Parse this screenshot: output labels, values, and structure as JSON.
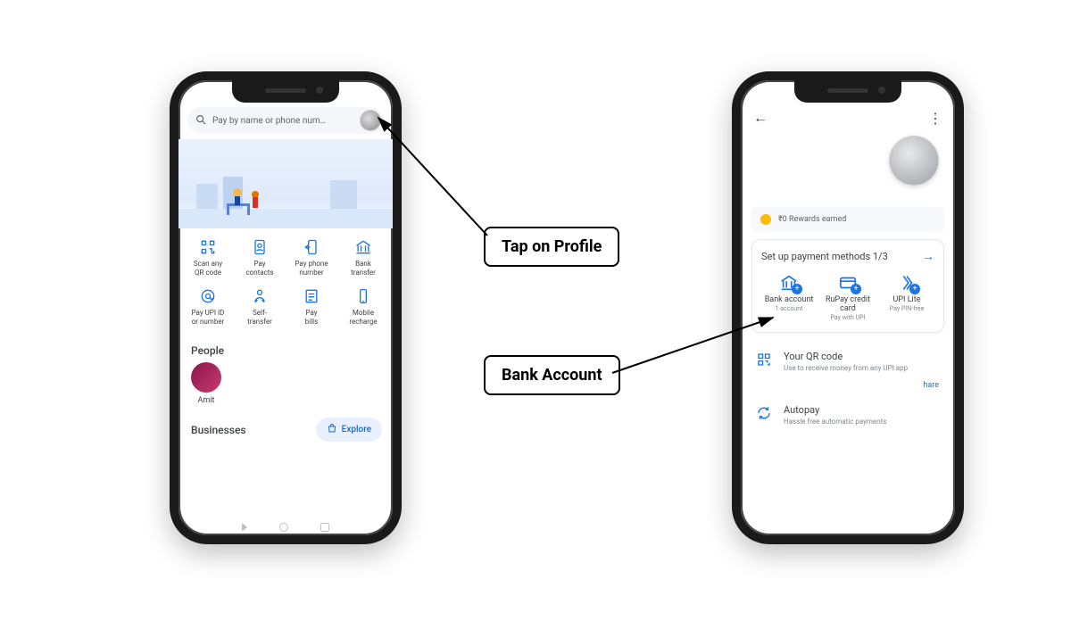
{
  "left": {
    "search_placeholder": "Pay by name or phone num…",
    "actions": [
      {
        "label1": "Scan any",
        "label2": "QR code"
      },
      {
        "label1": "Pay",
        "label2": "contacts"
      },
      {
        "label1": "Pay phone",
        "label2": "number"
      },
      {
        "label1": "Bank",
        "label2": "transfer"
      },
      {
        "label1": "Pay UPI ID",
        "label2": "or number"
      },
      {
        "label1": "Self-",
        "label2": "transfer"
      },
      {
        "label1": "Pay",
        "label2": "bills"
      },
      {
        "label1": "Mobile",
        "label2": "recharge"
      }
    ],
    "people_heading": "People",
    "people": [
      {
        "name": "Amit"
      }
    ],
    "businesses_heading": "Businesses",
    "explore_label": "Explore"
  },
  "right": {
    "rewards_text": "₹0 Rewards earned",
    "setup_title": "Set up payment methods 1/3",
    "methods": [
      {
        "title": "Bank account",
        "sub": "1 account"
      },
      {
        "title": "RuPay credit card",
        "sub": "Pay with UPI"
      },
      {
        "title": "UPI Lite",
        "sub": "Pay PIN-free"
      }
    ],
    "qr_title": "Your QR code",
    "qr_sub": "Use to receive money from any UPI app",
    "share_label": "hare",
    "autopay_title": "Autopay",
    "autopay_sub": "Hassle free automatic payments"
  },
  "callouts": {
    "profile": "Tap on Profile",
    "bank": "Bank Account"
  }
}
